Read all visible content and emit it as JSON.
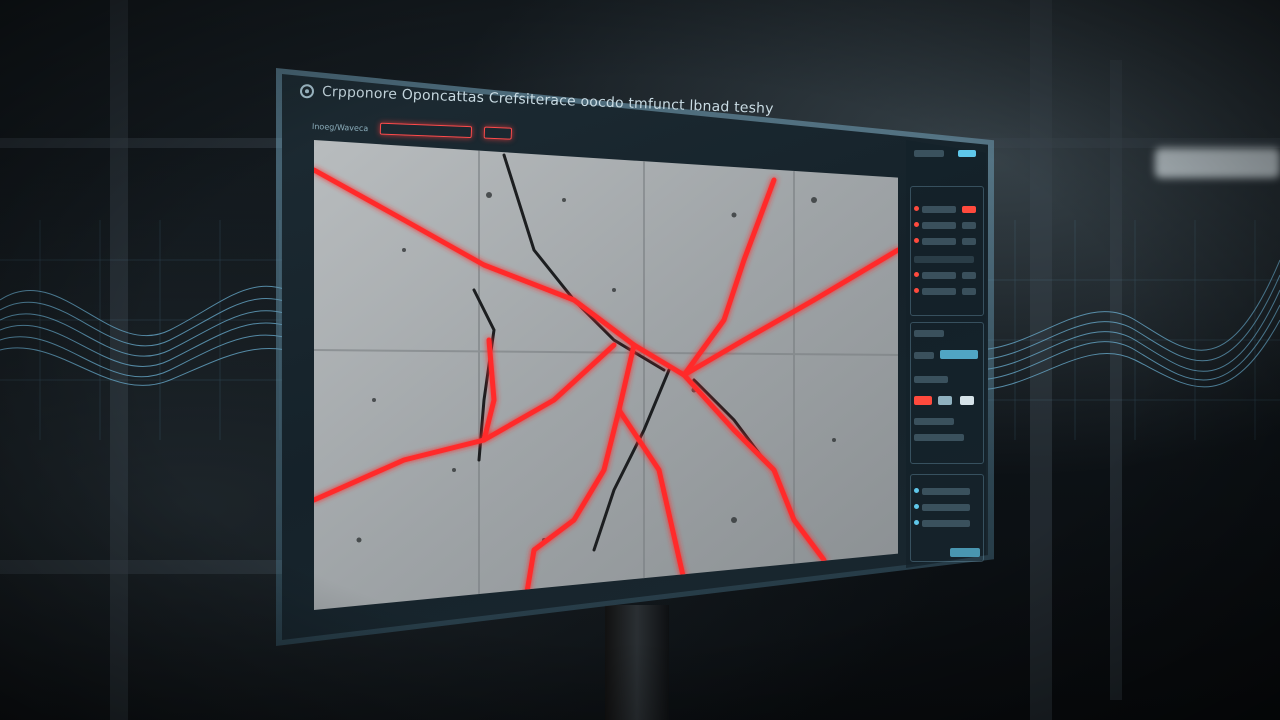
{
  "window": {
    "title": "Crpponore Oponcattas Crefsiterace oocdo tmfunct lbnad teshy",
    "icon": "app-logo-icon"
  },
  "toolbar": {
    "tab_label": "Inoeg/Waveca",
    "active_tab_icon": "analysis-tab",
    "small_tab_icon": "mode-tab"
  },
  "colors": {
    "crack_highlight": "#ff2a2a",
    "frame": "#7fb0c6",
    "wave": "#6fb8dc",
    "accent_cyan": "#5fc7ea",
    "status_red": "#ff4a3d"
  },
  "side_panel": {
    "icons": [
      "status-dot-icon",
      "status-dot-icon",
      "status-dot-icon",
      "status-dot-icon",
      "status-dot-icon",
      "status-dot-icon"
    ]
  }
}
